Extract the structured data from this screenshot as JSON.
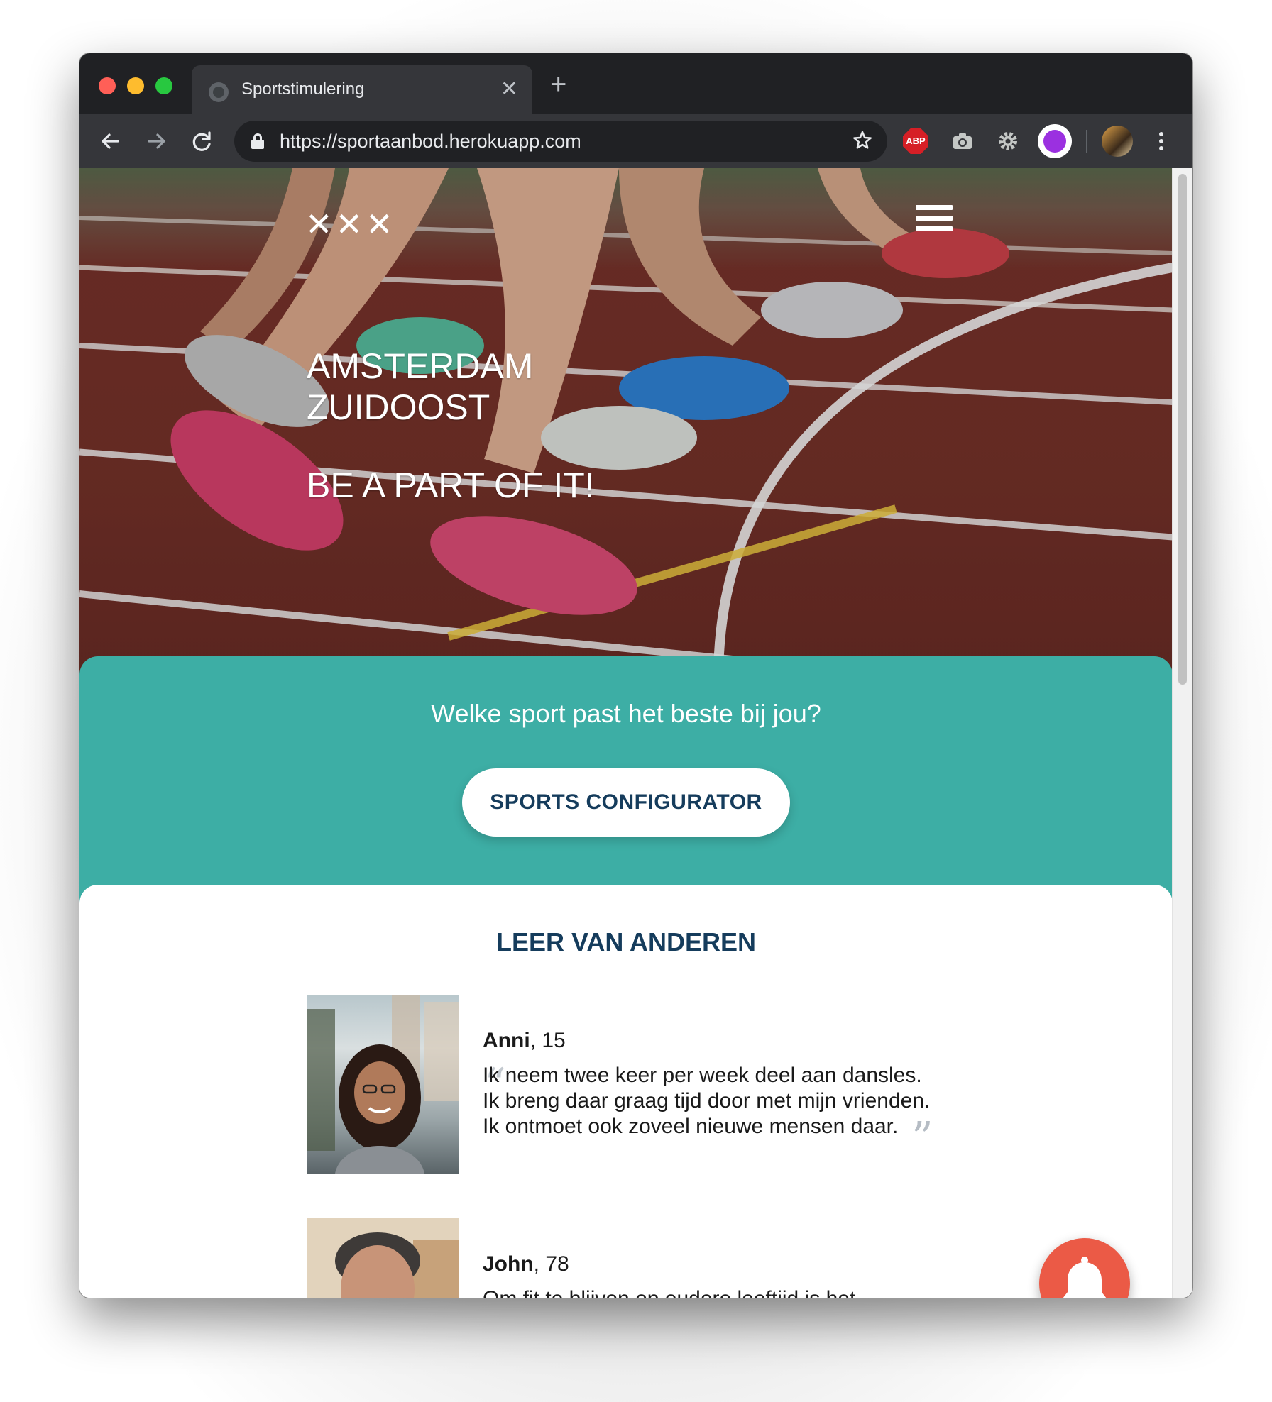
{
  "browser": {
    "tab_title": "Sportstimulering",
    "tab_close": "✕",
    "new_tab": "+",
    "url": "https://sportaanbod.herokuapp.com",
    "extensions": {
      "abp_label": "ABP"
    }
  },
  "header": {
    "logo": "✕✕✕"
  },
  "hero": {
    "title_line1": "AMSTERDAM",
    "title_line2": "ZUIDOOST",
    "tagline": "BE A PART OF IT!"
  },
  "configurator": {
    "question": "Welke sport past het beste bij jou?",
    "button_label": "SPORTS CONFIGURATOR",
    "background_color": "#3daea5"
  },
  "testimonials": {
    "section_title": "LEER VAN ANDEREN",
    "items": [
      {
        "name": "Anni",
        "age": ", 15",
        "quote": "Ik neem twee keer per week deel aan dansles. Ik breng daar graag tijd door met mijn vrienden. Ik ontmoet ook zoveel nieuwe mensen daar."
      },
      {
        "name": "John",
        "age": ", 78",
        "quote": "Om fit te blijven op oudere leeftijd is het"
      }
    ]
  },
  "notification_fab": {
    "icon": "bell-icon",
    "color": "#eb5a46"
  }
}
